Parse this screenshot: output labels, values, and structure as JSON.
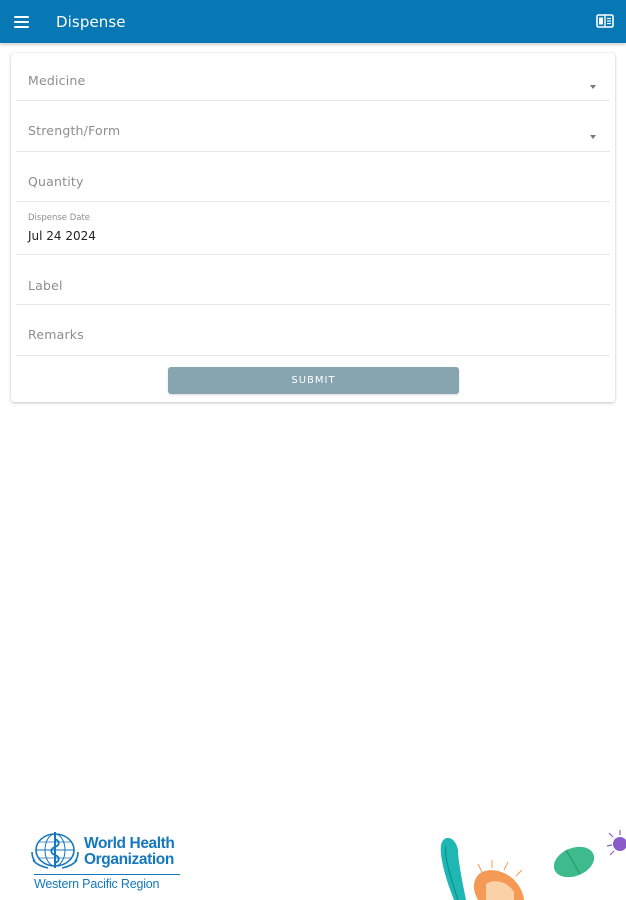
{
  "appbar": {
    "title": "Dispense",
    "menu_icon": "menu-icon",
    "action_icon": "book-icon",
    "color": "#0778b3"
  },
  "form": {
    "medicine": {
      "placeholder": "Medicine"
    },
    "strength_form": {
      "placeholder": "Strength/Form"
    },
    "quantity": {
      "placeholder": "Quantity"
    },
    "dispense_date": {
      "label": "Dispense Date",
      "value": "Jul 24 2024"
    },
    "label": {
      "placeholder": "Label"
    },
    "remarks": {
      "placeholder": "Remarks"
    },
    "submit_label": "SUBMIT",
    "submit_color": "#87a4b1"
  },
  "footer": {
    "org_name_line1": "World Health",
    "org_name_line2": "Organization",
    "region": "Western Pacific Region",
    "brand_color": "#1577bd"
  }
}
